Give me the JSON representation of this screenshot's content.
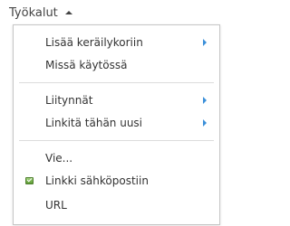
{
  "toolbar": {
    "label": "Työkalut",
    "caret_icon": "caret-up-icon"
  },
  "menu": {
    "items": [
      {
        "label": "Lisää keräilykoriin",
        "submenu": true
      },
      {
        "label": "Missä käytössä",
        "submenu": false
      },
      {
        "label": "Liitynnät",
        "submenu": true
      },
      {
        "label": "Linkitä tähän uusi",
        "submenu": true
      },
      {
        "label": "Vie...",
        "submenu": false
      },
      {
        "label": "Linkki sähköpostiin",
        "submenu": false,
        "icon": "email-link-icon"
      },
      {
        "label": "URL",
        "submenu": false
      }
    ],
    "submenu_arrow_color": "#3b8fd9",
    "border_color": "#c6c6c6"
  }
}
